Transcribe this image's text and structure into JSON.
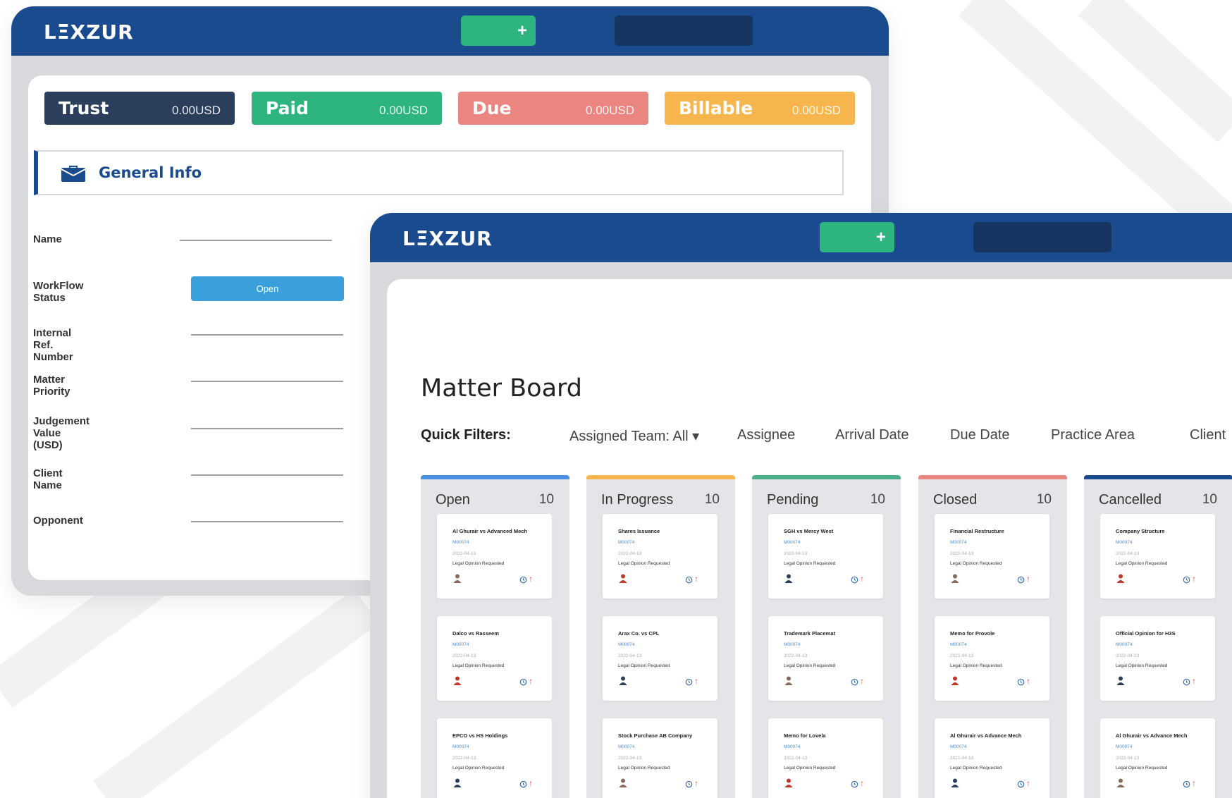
{
  "colors": {
    "brand": "#1b4b8f",
    "accent_green": "#2eb47f",
    "trust": "#2b3f5c",
    "paid": "#2eb47f",
    "due": "#eb857f",
    "billable": "#f7b54d",
    "workflow_open": "#3aa0dc"
  },
  "window1": {
    "logo": "LΞXZUR",
    "plus_label": "+",
    "balances": [
      {
        "label": "Trust",
        "value": "0.00USD"
      },
      {
        "label": "Paid",
        "value": "0.00USD"
      },
      {
        "label": "Due",
        "value": "0.00USD"
      },
      {
        "label": "Billable",
        "value": "0.00USD"
      }
    ],
    "general_info": {
      "icon": "briefcase-icon",
      "title": "General Info"
    },
    "fields": {
      "name": "Name",
      "workflow_status": "WorkFlow Status",
      "workflow_value": "Open",
      "internal_ref": "Internal Ref. Number",
      "matter_priority": "Matter Priority",
      "judgement_value_1": "Judgement",
      "judgement_value_2": "Value (USD)",
      "client_name": "Client Name",
      "opponent": "Opponent"
    }
  },
  "window2": {
    "logo": "LΞXZUR",
    "plus_label": "+",
    "title": "Matter Board",
    "quick_filters": {
      "label": "Quick Filters:",
      "assigned_team": "Assigned Team: All ▾",
      "assignee": "Assignee",
      "arrival_date": "Arrival Date",
      "due_date": "Due Date",
      "practice_area": "Practice Area",
      "client": "Client"
    },
    "columns": [
      {
        "name": "Open",
        "count": "10",
        "color": "#4a90e2",
        "cards": [
          {
            "title": "Al Ghurair vs Advanced Mech",
            "id": "M00074",
            "date": "2022-04-13",
            "status": "Legal Opinion Requested"
          },
          {
            "title": "Dalco vs Rasseem",
            "id": "M00074",
            "date": "2022-04-13",
            "status": "Legal Opinion Requested"
          },
          {
            "title": "EPCO vs HS Holdings",
            "id": "M00074",
            "date": "2022-04-13",
            "status": "Legal Opinion Requested"
          }
        ]
      },
      {
        "name": "In Progress",
        "count": "10",
        "color": "#f7b54d",
        "cards": [
          {
            "title": "Shares Issuance",
            "id": "M00074",
            "date": "2022-04-13",
            "status": "Legal Opinion Requested"
          },
          {
            "title": "Arax Co. vs CPL",
            "id": "M00074",
            "date": "2022-04-13",
            "status": "Legal Opinion Requested"
          },
          {
            "title": "Stock Purchase AB Company",
            "id": "M00074",
            "date": "2022-04-13",
            "status": "Legal Opinion Requested"
          }
        ]
      },
      {
        "name": "Pending",
        "count": "10",
        "color": "#4caf8a",
        "cards": [
          {
            "title": "SGH vs Mercy West",
            "id": "M00074",
            "date": "2022-04-13",
            "status": "Legal Opinion Requested"
          },
          {
            "title": "Trademark Placemat",
            "id": "M00074",
            "date": "2022-04-13",
            "status": "Legal Opinion Requested"
          },
          {
            "title": "Memo for Lovela",
            "id": "M00074",
            "date": "2022-04-13",
            "status": "Legal Opinion Requested"
          }
        ]
      },
      {
        "name": "Closed",
        "count": "10",
        "color": "#eb857f",
        "cards": [
          {
            "title": "Financial Restructure",
            "id": "M00074",
            "date": "2022-04-13",
            "status": "Legal Opinion Requested"
          },
          {
            "title": "Memo for Provole",
            "id": "M00074",
            "date": "2022-04-13",
            "status": "Legal Opinion Requested"
          },
          {
            "title": "Al Ghurair vs Advance Mech",
            "id": "M00074",
            "date": "2022-04-13",
            "status": "Legal Opinion Requested"
          }
        ]
      },
      {
        "name": "Cancelled",
        "count": "10",
        "color": "#1b4b8f",
        "cards": [
          {
            "title": "Company Structure",
            "id": "M00074",
            "date": "2022-04-13",
            "status": "Legal Opinion Requested"
          },
          {
            "title": "Official Opinion for H3S",
            "id": "M00074",
            "date": "2022-04-13",
            "status": "Legal Opinion Requested"
          },
          {
            "title": "Al Ghurair vs Advance Mech",
            "id": "M00074",
            "date": "2022-04-13",
            "status": "Legal Opinion Requested"
          }
        ]
      }
    ]
  }
}
